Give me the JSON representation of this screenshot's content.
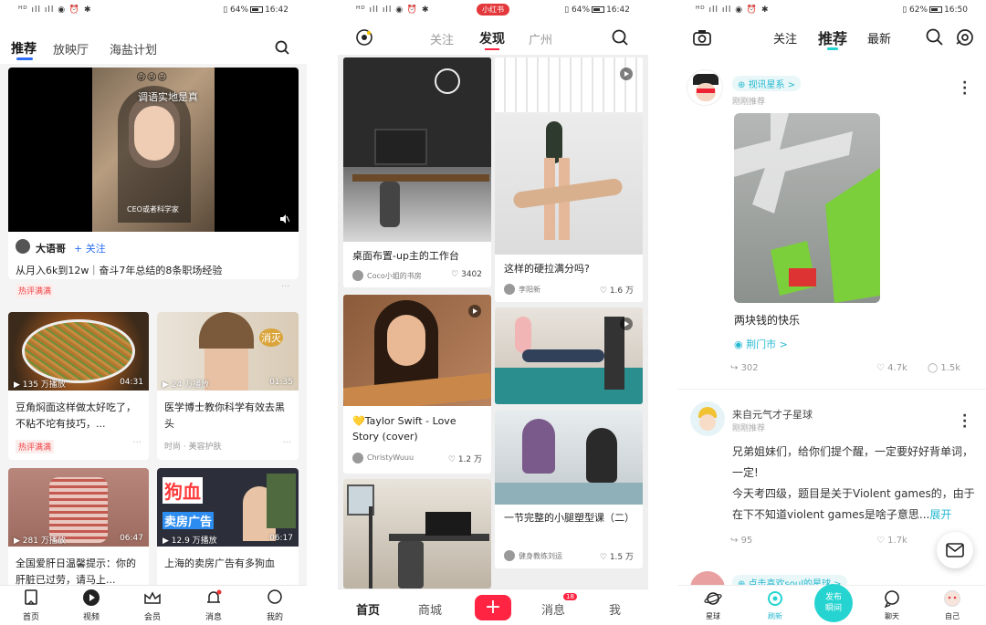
{
  "status": {
    "left": "ᴴᴰ ıll ıll ◉ ⏰ ✱",
    "p1_time": "16:42",
    "p1_batt": "64%",
    "p2_time": "16:42",
    "p2_batt": "64%",
    "p2_badge": "小红书",
    "p3_time": "16:50",
    "p3_batt": "62%"
  },
  "p1": {
    "tabs": [
      "推荐",
      "放映厅",
      "海盐计划"
    ],
    "featured": {
      "overlay_title": "调语实地是真",
      "caption": "CEO或者科学家",
      "author": "大语哥",
      "follow": "+ 关注",
      "title": "从月入6k到12w｜奋斗7年总结的8条职场经验",
      "tag": "热评满满"
    },
    "cards": [
      {
        "views": "▶ 135 万播放",
        "duration": "04:31",
        "title": "豆角焖面这样做太好吃了，不粘不坨有技巧，...",
        "tag": "热评满满",
        "sub": ""
      },
      {
        "views": "▶ 24 万播放",
        "duration": "01:35",
        "title": "医学博士教你科学有效去黑头",
        "tag": "",
        "sub": "时尚 · 美容护肤",
        "overlay": "消灭"
      },
      {
        "views": "▶ 281 万播放",
        "duration": "06:47",
        "title": "全国爱肝日温馨提示：你的肝脏已过劳，请马上...",
        "tag": "",
        "sub": ""
      },
      {
        "views": "▶ 12.9 万播放",
        "duration": "06:17",
        "title": "上海的卖房广告有多狗血",
        "tag": "",
        "sub": "",
        "big1": "狗血",
        "big2": "卖房广告"
      }
    ],
    "nav": [
      "首页",
      "视频",
      "会员",
      "消息",
      "我的"
    ]
  },
  "p2": {
    "tabs": [
      "关注",
      "发现",
      "广州"
    ],
    "left": [
      {
        "title": "桌面布置-up主的工作台",
        "author": "Coco小姐的书房",
        "likes": "3402"
      },
      {
        "title": "💛Taylor Swift - Love Story (cover)",
        "author": "ChristyWuuu",
        "likes": "1.2 万"
      }
    ],
    "right": [
      {
        "title": "这样的硬拉满分吗?",
        "author": "李阳新",
        "likes": "1.6 万"
      },
      {
        "title": "一节完整的小腿塑型课（二）",
        "author": "健身教练刘运",
        "likes": "1.5 万"
      }
    ],
    "nav": {
      "home": "首页",
      "shop": "商城",
      "msg": "消息",
      "msg_badge": "18",
      "me": "我",
      "plus": "+"
    }
  },
  "p3": {
    "tabs": [
      "关注",
      "推荐",
      "最新"
    ],
    "post1": {
      "planet": "视讯星系 >",
      "time": "刚刚推荐",
      "caption": "两块钱的快乐",
      "loc": "荆门市 >",
      "share": "302",
      "like": "4.7k",
      "comment": "1.5k"
    },
    "post2": {
      "author": "来自元气才子星球",
      "time": "刚刚推荐",
      "text1": "兄弟姐妹们，给你们提个醒，一定要好好背单词，一定!",
      "text2": "今天考四级，题目是关于Violent games的，由于在下不知道violent games是啥子意思...",
      "more": "展开",
      "share": "95",
      "like": "1.7k"
    },
    "post3": {
      "planet": "点击喜欢soul的星球 >"
    },
    "nav": {
      "planet": "星球",
      "refresh": "刷新",
      "publish": "发布\n瞬间",
      "chat": "聊天",
      "me": "自己"
    }
  }
}
